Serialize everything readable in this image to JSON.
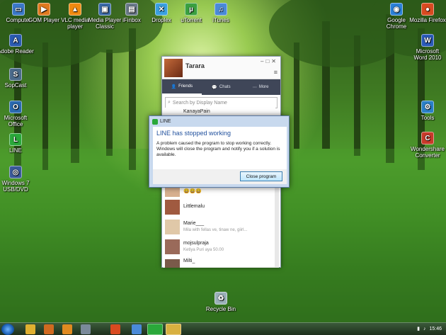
{
  "desktop_icons": [
    {
      "label": "Computer",
      "icon": "computer-icon",
      "color": "#3a78c8"
    },
    {
      "label": "GOM Player",
      "icon": "gom-player-icon",
      "color": "#e07a20"
    },
    {
      "label": "VLC media player",
      "icon": "vlc-icon",
      "color": "#f08a10"
    },
    {
      "label": "Media Player Classic",
      "icon": "media-player-classic-icon",
      "color": "#3a6aa8"
    },
    {
      "label": "iFinbox",
      "icon": "ifinbox-icon",
      "color": "#6a7a8a"
    },
    {
      "label": "Droplex",
      "icon": "droplex-icon",
      "color": "#3aa0e0"
    },
    {
      "label": "uTorrent",
      "icon": "utorrent-icon",
      "color": "#3aa040"
    },
    {
      "label": "iTunes",
      "icon": "itunes-icon",
      "color": "#4a8ad8"
    },
    {
      "label": "Google Chrome",
      "icon": "chrome-icon",
      "color": "#2a80d8"
    },
    {
      "label": "Mozilla Firefox",
      "icon": "firefox-icon",
      "color": "#d84a20"
    },
    {
      "label": "Adobe Reader",
      "icon": "adobe-reader-icon",
      "color": "#2a5ab0"
    },
    {
      "label": "Microsoft Word 2010",
      "icon": "word-icon",
      "color": "#2a5ab8"
    },
    {
      "label": "SopCast",
      "icon": "sopcast-icon",
      "color": "#4a6a8a"
    },
    {
      "label": "Microsoft Office",
      "icon": "office-icon",
      "color": "#2a6ab0"
    },
    {
      "label": "Tools",
      "icon": "tools-icon",
      "color": "#2a80c8"
    },
    {
      "label": "LINE",
      "icon": "line-icon",
      "color": "#2aa83a"
    },
    {
      "label": "Wondershare Converter",
      "icon": "converter-icon",
      "color": "#c83a2a"
    },
    {
      "label": "Windows 7 USB/DVD",
      "icon": "usb-dvd-icon",
      "color": "#3a5a9a"
    },
    {
      "label": "Recycle Bin",
      "icon": "recycle-bin-icon",
      "color": "#9ab0b8"
    }
  ],
  "line_window": {
    "title": "Tarara",
    "tabs": [
      "Friends",
      "Chats",
      "More"
    ],
    "search_placeholder": "Search by Display Name",
    "contacts": [
      {
        "name": "KanayaPain",
        "status": ""
      },
      {
        "name": "",
        "status": "😄😄😄"
      },
      {
        "name": "Littlemalu",
        "status": ""
      },
      {
        "name": "Marie___",
        "status": "Mila with fellas ve, tinaw ne, giirl..."
      },
      {
        "name": "mojsulpraja",
        "status": "Ketiya Puri aya 50.00"
      },
      {
        "name": "Milti_",
        "status": ""
      }
    ]
  },
  "error_dialog": {
    "title": "LINE",
    "heading": "LINE has stopped working",
    "message": "A problem caused the program to stop working correctly. Windows will close the program and notify you if a solution is available.",
    "button": "Close program"
  },
  "taskbar": {
    "time": "15:46"
  }
}
